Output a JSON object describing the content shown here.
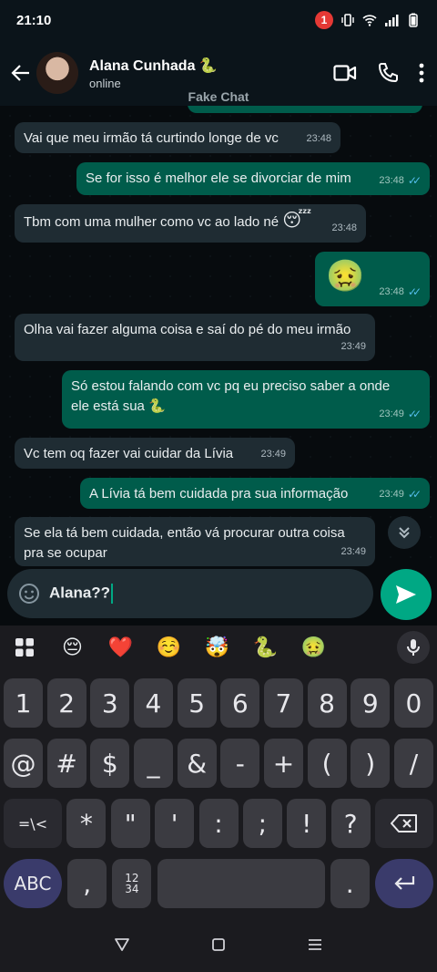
{
  "status": {
    "time": "21:10",
    "notification_count": "1"
  },
  "header": {
    "contact_name": "Alana Cunhada",
    "name_emoji": "🐍",
    "subtitle": "online",
    "app_label": "Fake Chat"
  },
  "messages": [
    {
      "dir": "in",
      "text": "Vai que meu irmão tá curtindo longe de vc",
      "time": "23:48"
    },
    {
      "dir": "out",
      "text": "Se for isso é melhor ele se divorciar de mim",
      "time": "23:48",
      "read": true
    },
    {
      "dir": "in",
      "text": "Tbm com uma mulher como vc ao lado né",
      "emoji": "😴",
      "time": "23:48"
    },
    {
      "dir": "out",
      "emoji": "🤢",
      "time": "23:48",
      "read": true
    },
    {
      "dir": "in",
      "text": "Olha vai fazer alguma coisa e saí do pé do meu irmão",
      "time": "23:49"
    },
    {
      "dir": "out",
      "text_line1": "Só estou falando com vc pq eu preciso saber a onde",
      "text_line2": "ele está sua",
      "emoji": "🐍",
      "time": "23:49",
      "read": true
    },
    {
      "dir": "in",
      "text": "Vc tem oq fazer vai cuidar da Lívia",
      "time": "23:49"
    },
    {
      "dir": "out",
      "text": "A Lívia tá bem cuidada pra sua informação",
      "time": "23:49",
      "read": true
    },
    {
      "dir": "in",
      "text_line1": "Se ela tá bem cuidada, então vá procurar outra coisa",
      "text_line2": "pra se ocupar",
      "time": "23:49"
    }
  ],
  "input": {
    "value": "Alana??"
  },
  "keyboard": {
    "emoji_row": [
      "😔",
      "❤️",
      "☺️",
      "🤯",
      "🐍",
      "🤢"
    ],
    "row1": [
      "1",
      "2",
      "3",
      "4",
      "5",
      "6",
      "7",
      "8",
      "9",
      "0"
    ],
    "row2": [
      "@",
      "#",
      "$",
      "_",
      "&",
      "-",
      "+",
      "(",
      ")",
      "/"
    ],
    "row3_left": "=\\<",
    "row3": [
      "*",
      "\"",
      "'",
      ":",
      ";",
      "!",
      "?"
    ],
    "row4_left": "ABC",
    "row4_comma": ",",
    "row4_numpad": "12\n34",
    "row4_dot": "."
  },
  "colors": {
    "accent": "#00a884",
    "bubble_out": "#005c4b",
    "bubble_in": "#1f2c33",
    "tick": "#53bdeb"
  }
}
